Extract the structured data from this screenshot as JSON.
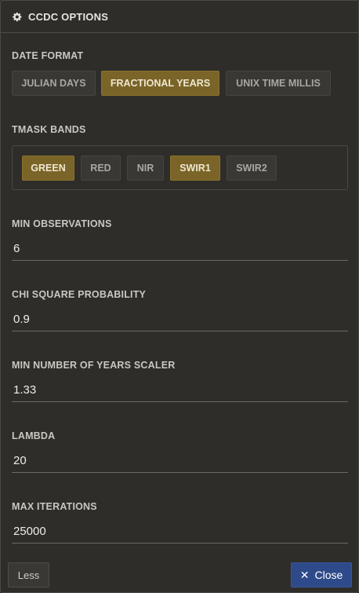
{
  "header": {
    "title": "CCDC OPTIONS",
    "icon": "gear-icon"
  },
  "date_format": {
    "label": "DATE FORMAT",
    "options": [
      {
        "label": "JULIAN DAYS",
        "active": false
      },
      {
        "label": "FRACTIONAL YEARS",
        "active": true
      },
      {
        "label": "UNIX TIME MILLIS",
        "active": false
      }
    ]
  },
  "tmask_bands": {
    "label": "TMASK BANDS",
    "options": [
      {
        "label": "GREEN",
        "active": true
      },
      {
        "label": "RED",
        "active": false
      },
      {
        "label": "NIR",
        "active": false
      },
      {
        "label": "SWIR1",
        "active": true
      },
      {
        "label": "SWIR2",
        "active": false
      }
    ]
  },
  "fields": {
    "min_observations": {
      "label": "MIN OBSERVATIONS",
      "value": "6"
    },
    "chi_square_probability": {
      "label": "CHI SQUARE PROBABILITY",
      "value": "0.9"
    },
    "min_years_scaler": {
      "label": "MIN NUMBER OF YEARS SCALER",
      "value": "1.33"
    },
    "lambda": {
      "label": "LAMBDA",
      "value": "20"
    },
    "max_iterations": {
      "label": "MAX ITERATIONS",
      "value": "25000"
    }
  },
  "footer": {
    "less_label": "Less",
    "close_label": "Close"
  },
  "colors": {
    "accent_active": "#7a6427",
    "close_button": "#2f4a8a",
    "panel_bg": "#2e2d2a"
  }
}
